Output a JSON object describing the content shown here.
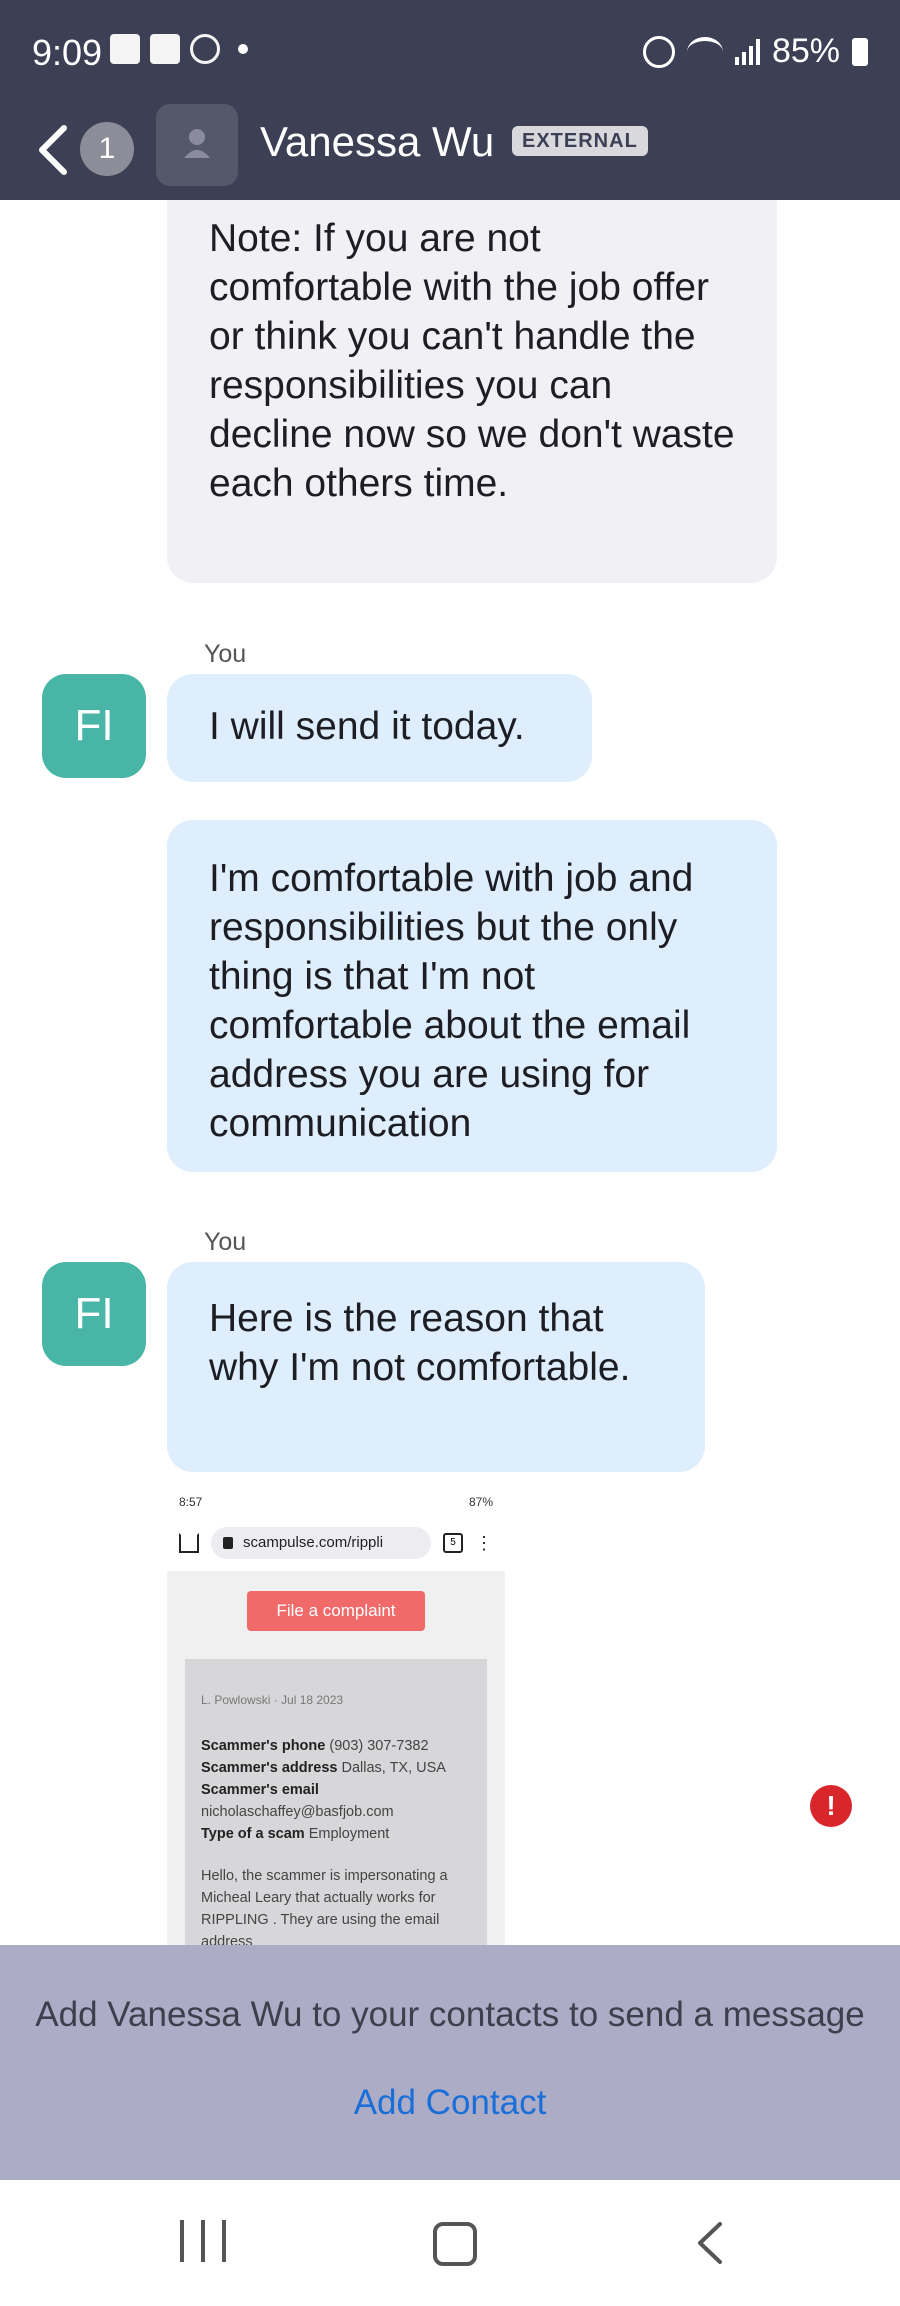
{
  "status_bar": {
    "time": "9:09",
    "battery": "85%"
  },
  "header": {
    "unread_count": "1",
    "contact_name": "Vanessa Wu",
    "tag": "EXTERNAL"
  },
  "messages": [
    {
      "text": "Note: If you are not comfortable with the job offer or think you can't handle the responsibilities you can decline now so we don't waste each others time."
    },
    {
      "sender": "You",
      "avatar": "FI",
      "text": "I will send it today."
    },
    {
      "text": "I'm comfortable with job and responsibilities but the only thing is that I'm not comfortable about the email address you are using for communication"
    },
    {
      "sender": "You",
      "avatar": "FI",
      "text": "Here is the reason that why I'm not comfortable."
    }
  ],
  "attachment": {
    "status_time": "8:57",
    "status_battery": "87%",
    "url": "scampulse.com/rippli",
    "tab_count": "5",
    "button": "File a complaint",
    "author": "L. Powlowski",
    "date": "Jul 18 2023",
    "phone_label": "Scammer's phone",
    "phone": "(903) 307-7382",
    "address_label": "Scammer's address",
    "address": "Dallas, TX, USA",
    "email_label": "Scammer's email",
    "email": "nicholaschaffey@basfjob.com",
    "type_label": "Type of a scam",
    "type": "Employment",
    "body": "Hello, the scammer is impersonating a Micheal Leary that actually works for RIPPLING . They are using the email address"
  },
  "panel": {
    "message": "Add Vanessa Wu to your contacts to send a message",
    "action": "Add Contact"
  }
}
